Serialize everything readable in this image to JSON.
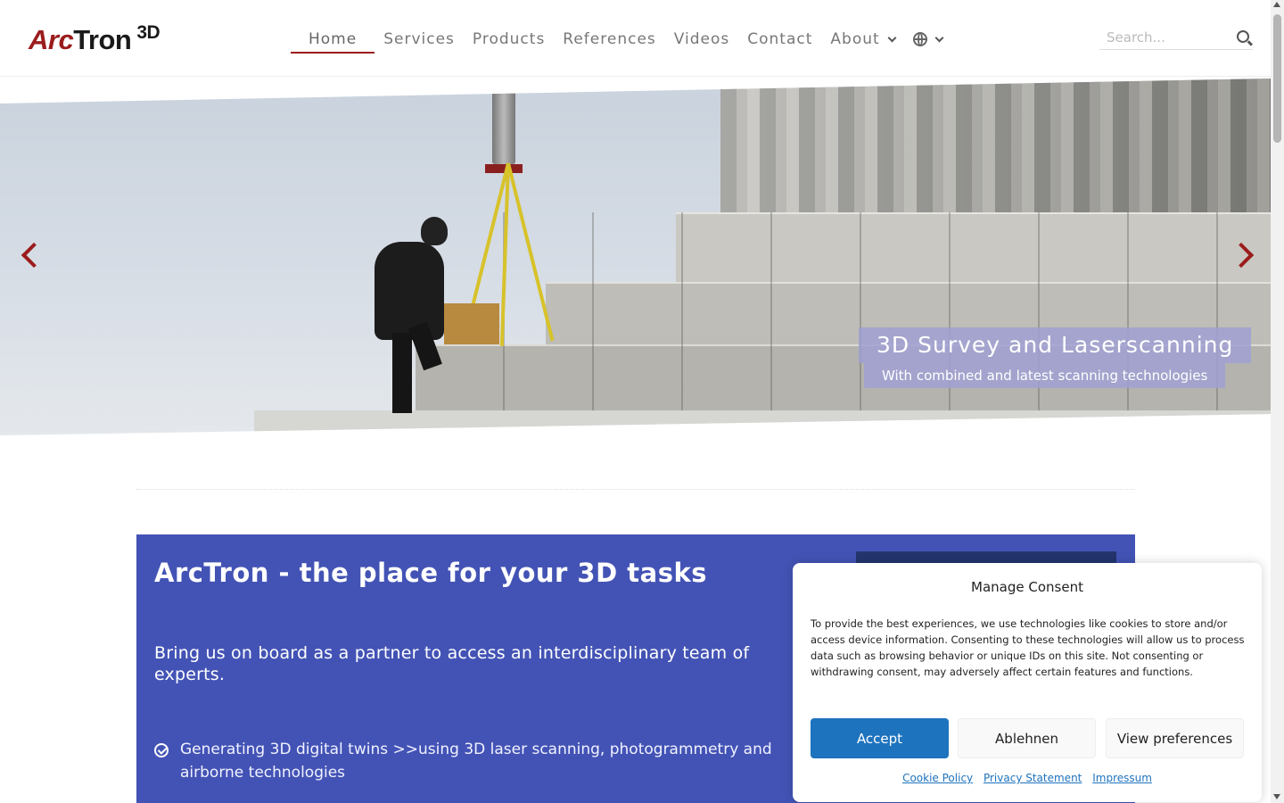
{
  "header": {
    "logo": {
      "part1": "Arc",
      "part2": "Tron",
      "sup": "3D"
    },
    "nav": [
      {
        "label": "Home",
        "active": true
      },
      {
        "label": "Services"
      },
      {
        "label": "Products"
      },
      {
        "label": "References"
      },
      {
        "label": "Videos"
      },
      {
        "label": "Contact"
      },
      {
        "label": "About",
        "has_dropdown": true
      }
    ],
    "language_icon": "globe-icon",
    "search": {
      "placeholder": "Search..."
    }
  },
  "hero": {
    "caption_title": "3D Survey and Laserscanning",
    "caption_subtitle": "With combined and latest scanning technologies",
    "arrow_color": "#9b1c1c",
    "caption_bg": "#a0a0d2"
  },
  "intro": {
    "title": "ArcTron - the place for your 3D tasks",
    "subtitle": "Bring us on board as a partner to access an interdisciplinary team of experts.",
    "bullets": [
      "Generating 3D digital twins >>using 3D laser scanning, photogrammetry and airborne technologies"
    ],
    "bg_color": "#4353b5"
  },
  "consent": {
    "title": "Manage Consent",
    "text": "To provide the best experiences, we use technologies like cookies to store and/or access device information. Consenting to these technologies will allow us to process data such as browsing behavior or unique IDs on this site. Not consenting or withdrawing consent, may adversely affect certain features and functions.",
    "accept": "Accept",
    "deny": "Ablehnen",
    "preferences": "View preferences",
    "links": [
      "Cookie Policy",
      "Privacy Statement",
      "Impressum"
    ],
    "accent_color": "#1e73be"
  }
}
